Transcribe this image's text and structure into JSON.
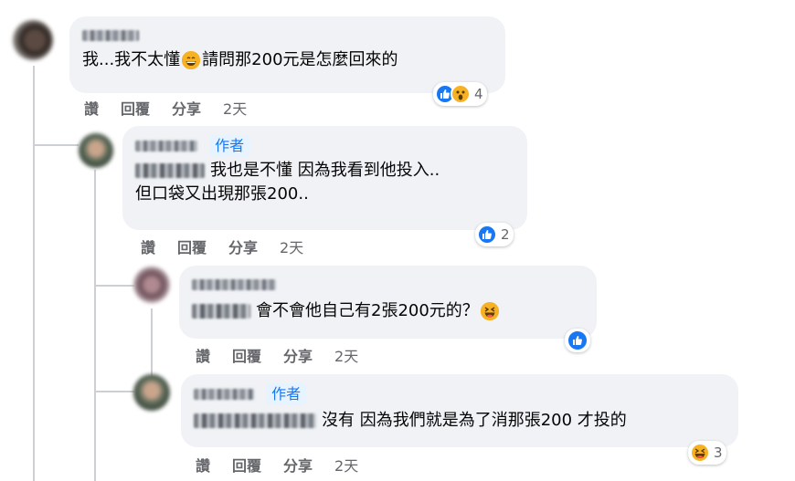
{
  "comments": [
    {
      "id": "c1",
      "text_before_emoji": "我...我不太懂",
      "text_after_emoji": "請問那200元是怎麼回來的",
      "reaction_count": "4",
      "actions": {
        "like": "讚",
        "reply": "回覆",
        "share": "分享",
        "time": "2天"
      }
    },
    {
      "id": "c2",
      "author_badge": "作者",
      "line1": "我也是不懂 因為我看到他投入..",
      "line2": "但口袋又出現那張200..",
      "reaction_count": "2",
      "actions": {
        "like": "讚",
        "reply": "回覆",
        "share": "分享",
        "time": "2天"
      }
    },
    {
      "id": "c3",
      "text": "會不會他自己有2張200元的？",
      "actions": {
        "like": "讚",
        "reply": "回覆",
        "share": "分享",
        "time": "2天"
      }
    },
    {
      "id": "c4",
      "author_badge": "作者",
      "text": "沒有 因為我們就是為了消那張200 才投的",
      "reaction_count": "3",
      "actions": {
        "like": "讚",
        "reply": "回覆",
        "share": "分享",
        "time": "2天"
      }
    }
  ],
  "colors": {
    "bubble": "#f0f2f5",
    "link_blue": "#1877f2",
    "meta_gray": "#65676b",
    "thread_line": "#ccd0d5"
  }
}
